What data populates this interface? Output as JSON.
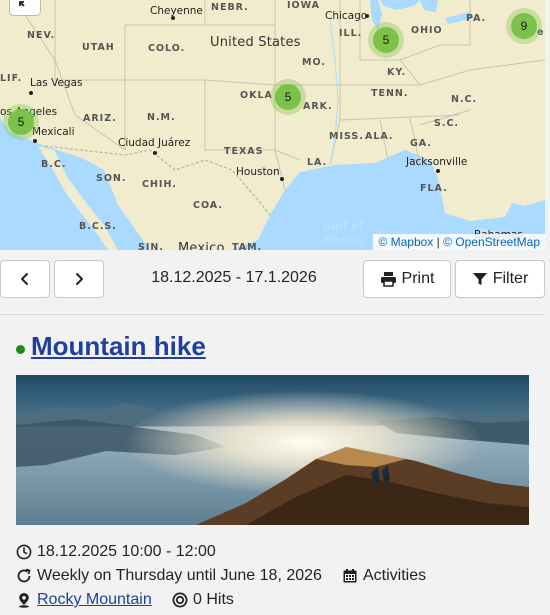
{
  "map": {
    "states": [
      {
        "id": "nebr",
        "label": "NEBR."
      },
      {
        "id": "iowa",
        "label": "IOWA"
      },
      {
        "id": "nev",
        "label": "NEV."
      },
      {
        "id": "utah",
        "label": "UTAH"
      },
      {
        "id": "colo",
        "label": "COLO."
      },
      {
        "id": "ill",
        "label": "ILL."
      },
      {
        "id": "ohio",
        "label": "OHIO"
      },
      {
        "id": "pa",
        "label": "PA."
      },
      {
        "id": "mo",
        "label": "MO."
      },
      {
        "id": "ky",
        "label": "KY."
      },
      {
        "id": "lif",
        "label": "LIF."
      },
      {
        "id": "okla",
        "label": "OKLA"
      },
      {
        "id": "tenn",
        "label": "TENN."
      },
      {
        "id": "nc",
        "label": "N.C."
      },
      {
        "id": "ariz",
        "label": "ARIZ."
      },
      {
        "id": "nm",
        "label": "N.M."
      },
      {
        "id": "ark",
        "label": "ARK."
      },
      {
        "id": "sc",
        "label": "S.C."
      },
      {
        "id": "miss",
        "label": "MISS."
      },
      {
        "id": "ala",
        "label": "ALA."
      },
      {
        "id": "ga",
        "label": "GA."
      },
      {
        "id": "bc",
        "label": "B.C."
      },
      {
        "id": "texas",
        "label": "TEXAS"
      },
      {
        "id": "son",
        "label": "SON."
      },
      {
        "id": "la",
        "label": "LA."
      },
      {
        "id": "chih",
        "label": "CHIH."
      },
      {
        "id": "fla",
        "label": "FLA."
      },
      {
        "id": "coa",
        "label": "COA."
      },
      {
        "id": "bcs",
        "label": "B.C.S."
      },
      {
        "id": "sin",
        "label": "SIN."
      },
      {
        "id": "tam",
        "label": "TAM."
      },
      {
        "id": "ev",
        "label": "ev"
      }
    ],
    "cities": [
      {
        "id": "cheyenne",
        "label": "Cheyenne"
      },
      {
        "id": "chicago",
        "label": "Chicago"
      },
      {
        "id": "las-vegas",
        "label": "Las Vegas"
      },
      {
        "id": "los-angeles",
        "label": "os Angeles"
      },
      {
        "id": "mexicali",
        "label": "Mexicali"
      },
      {
        "id": "ciudad-juarez",
        "label": "Ciudad Juárez"
      },
      {
        "id": "houston",
        "label": "Houston"
      },
      {
        "id": "jacksonville",
        "label": "Jacksonville"
      },
      {
        "id": "bahamas",
        "label": "Bahamas"
      }
    ],
    "countries": {
      "us": "United States",
      "mexico": "Mexico"
    },
    "water": {
      "line1": "Gulf of",
      "line2": "Mexico"
    },
    "clusters": [
      {
        "id": "midwest",
        "count": "5"
      },
      {
        "id": "northeast",
        "count": "9"
      },
      {
        "id": "california",
        "count": "5"
      },
      {
        "id": "south",
        "count": "5"
      }
    ],
    "attribution": {
      "mapbox": "© Mapbox",
      "separator": " | ",
      "osm": "© OpenStreetMap"
    },
    "colors": {
      "land": "#f1eccd",
      "water": "#aadaff",
      "cluster": "#7cc24a"
    }
  },
  "toolbar": {
    "prev_icon": "chevron-left-icon",
    "next_icon": "chevron-right-icon",
    "date_range": "18.12.2025 - 17.1.2026",
    "print_label": "Print",
    "filter_label": "Filter"
  },
  "event": {
    "title": "Mountain hike",
    "status_color": "#1a8a1a",
    "datetime": "18.12.2025 10:00 - 12:00",
    "recurrence": "Weekly on Thursday until June 18, 2026",
    "category": "Activities",
    "location": "Rocky Mountain",
    "hits": "0 Hits"
  }
}
